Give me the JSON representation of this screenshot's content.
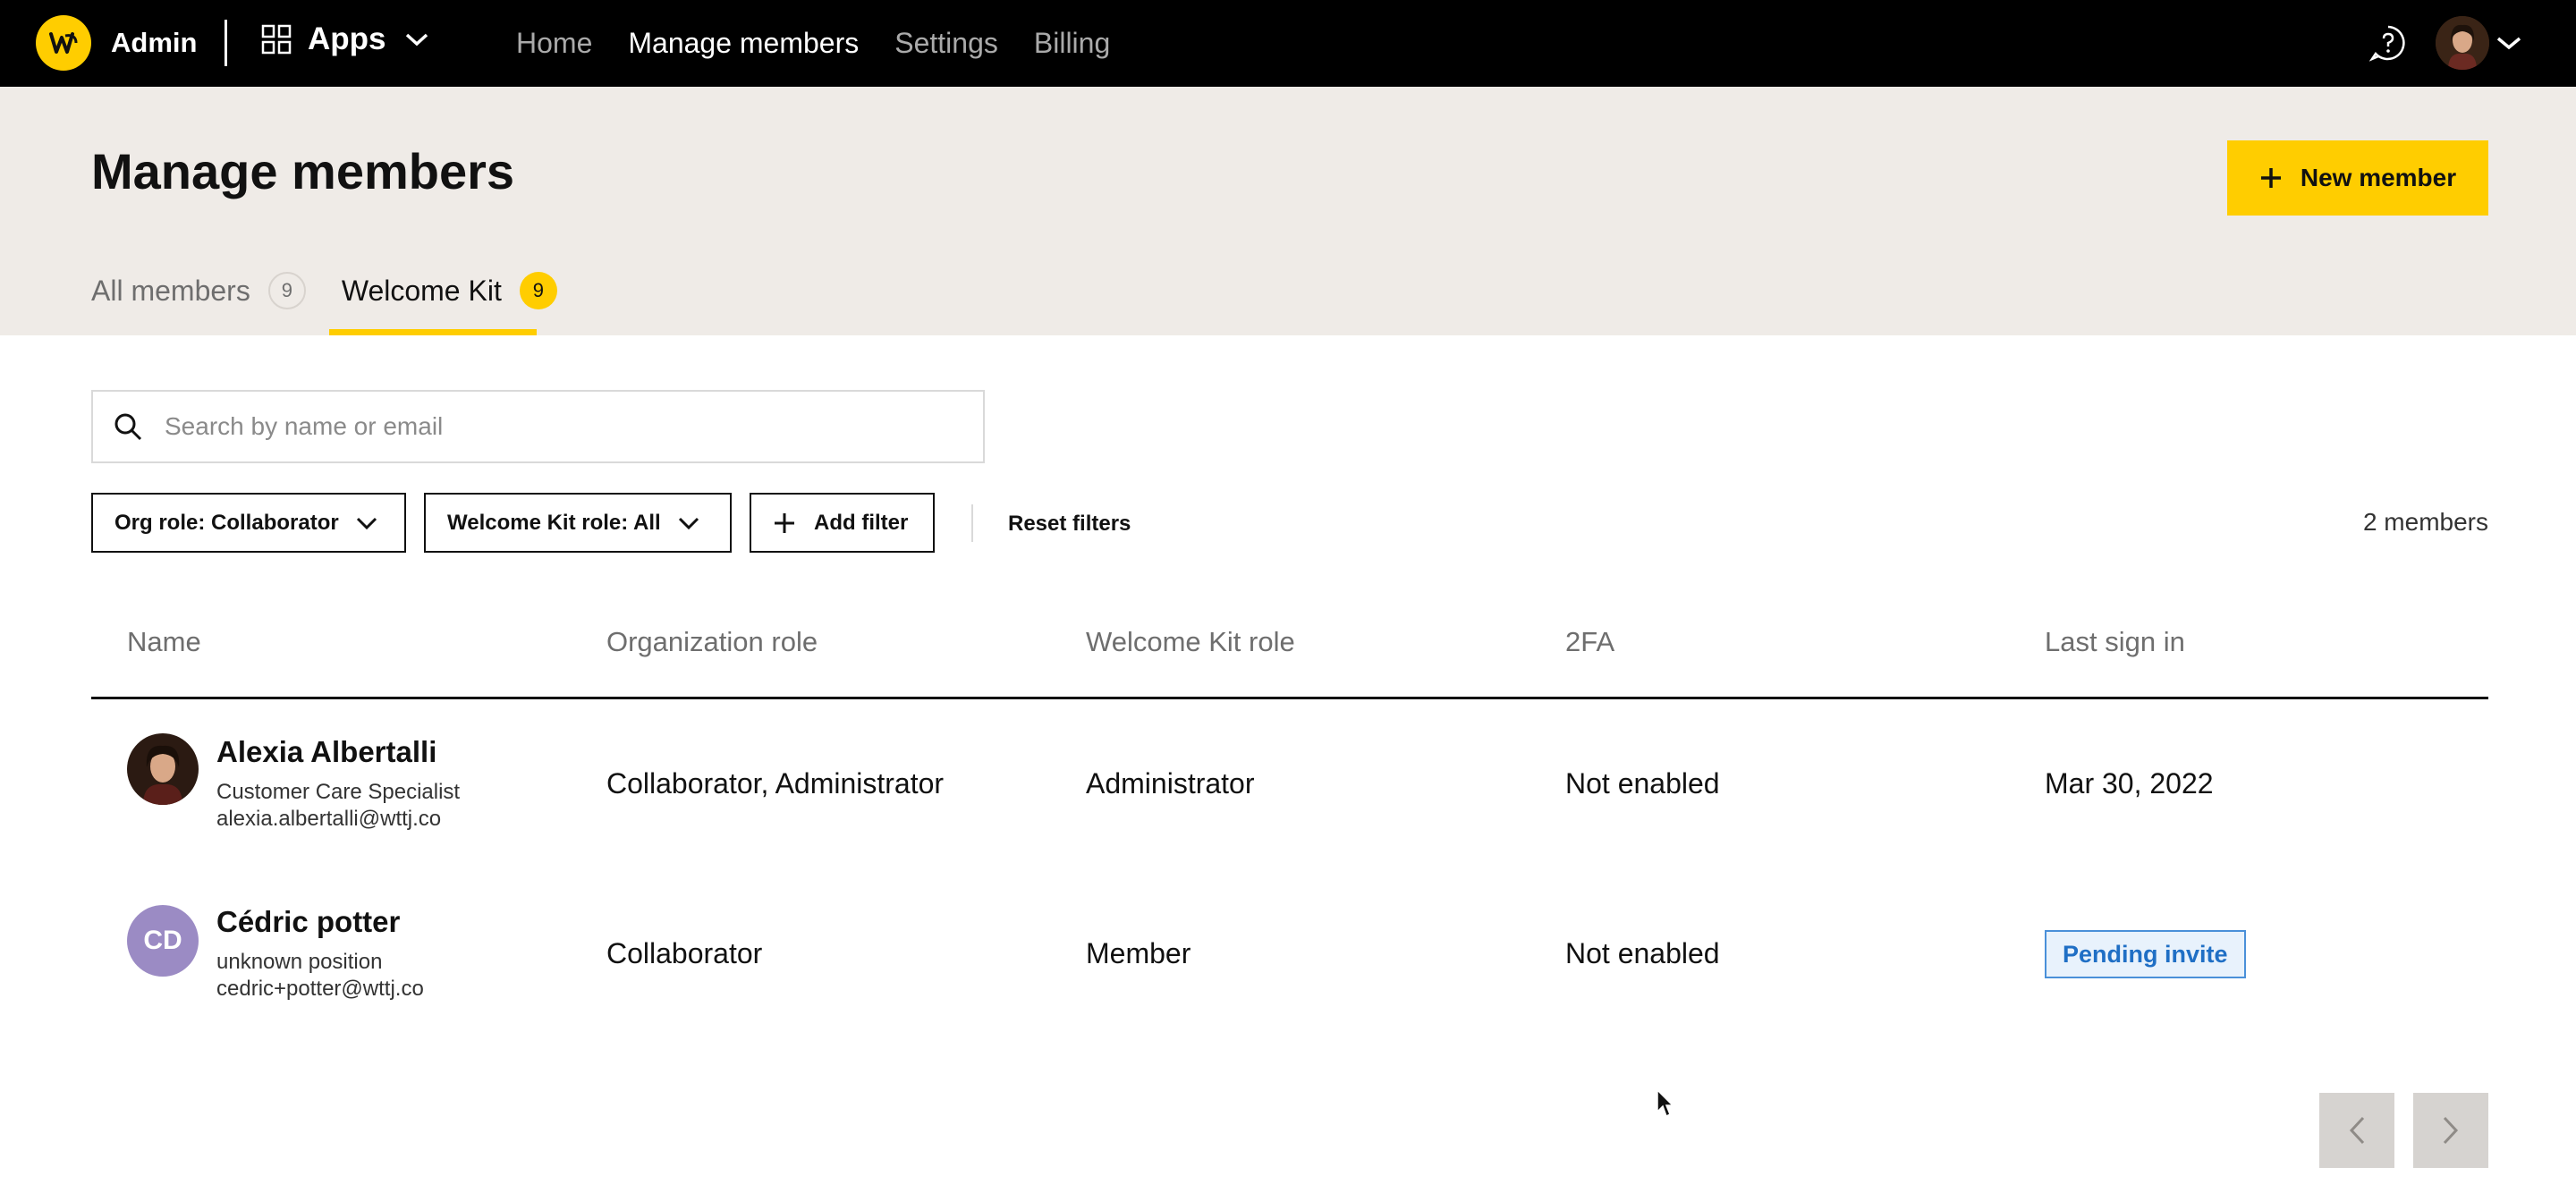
{
  "topnav": {
    "brand": "Admin",
    "apps_label": "Apps",
    "links": [
      "Home",
      "Manage members",
      "Settings",
      "Billing"
    ],
    "active_link": "Manage members",
    "icons": [
      "wttj-logo-icon",
      "apps-grid-icon",
      "chevron-down-icon",
      "help-icon",
      "user-avatar",
      "chevron-down-icon"
    ]
  },
  "header": {
    "title": "Manage members",
    "new_member_label": "New member",
    "tabs": [
      {
        "label": "All members",
        "count": "9"
      },
      {
        "label": "Welcome Kit",
        "count": "9"
      }
    ]
  },
  "search": {
    "placeholder": "Search by name or email",
    "value": ""
  },
  "filters": {
    "org_role": "Org role: Collaborator",
    "kit_role": "Welcome Kit role: All",
    "add_filter": "Add filter",
    "reset": "Reset filters",
    "count": "2 members"
  },
  "table": {
    "headers": [
      "Name",
      "Organization role",
      "Welcome Kit role",
      "2FA",
      "Last sign in"
    ],
    "rows": [
      {
        "name": "Alexia Albertalli",
        "position": "Customer Care Specialist",
        "email": "alexia.albertalli@wttj.co",
        "avatar": "photo",
        "org_role": "Collaborator, Administrator",
        "kit_role": "Administrator",
        "twofa": "Not enabled",
        "last_sign_in": "Mar 30, 2022"
      },
      {
        "name": "Cédric potter",
        "position": "unknown position",
        "email": "cedric+potter@wttj.co",
        "avatar": "CD",
        "org_role": "Collaborator",
        "kit_role": "Member",
        "twofa": "Not enabled",
        "last_sign_in": "Pending invite"
      }
    ]
  },
  "colors": {
    "accent": "#ffcd00",
    "nav_bg": "#000000",
    "header_bg": "#efebe7",
    "pending_blue": "#1f6fc5",
    "initials_bg": "#9b8bc4"
  }
}
